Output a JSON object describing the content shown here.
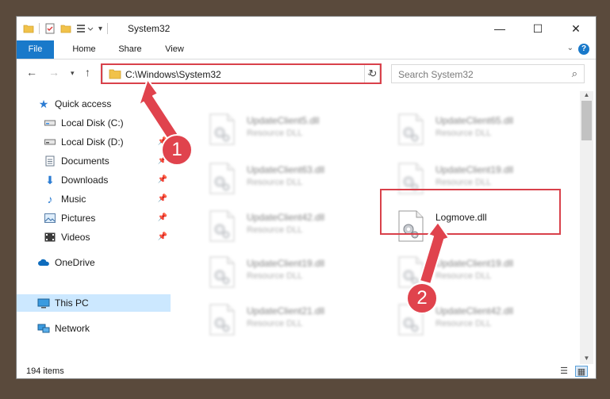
{
  "window": {
    "title": "System32"
  },
  "ribbon": {
    "tabs": [
      "File",
      "Home",
      "Share",
      "View"
    ]
  },
  "address": {
    "path": "C:\\Windows\\System32"
  },
  "search": {
    "placeholder": "Search System32"
  },
  "nav": {
    "items": [
      {
        "label": "Quick access",
        "icon": "star-icon"
      },
      {
        "label": "Local Disk (C:)",
        "icon": "drive-icon",
        "pinned": true
      },
      {
        "label": "Local Disk (D:)",
        "icon": "drive-icon",
        "pinned": true
      },
      {
        "label": "Documents",
        "icon": "documents-icon",
        "pinned": true
      },
      {
        "label": "Downloads",
        "icon": "downloads-icon",
        "pinned": true
      },
      {
        "label": "Music",
        "icon": "music-icon",
        "pinned": true
      },
      {
        "label": "Pictures",
        "icon": "pictures-icon",
        "pinned": true
      },
      {
        "label": "Videos",
        "icon": "videos-icon",
        "pinned": true
      },
      {
        "label": "OneDrive",
        "icon": "cloud-icon"
      },
      {
        "label": "This PC",
        "icon": "pc-icon",
        "selected": true
      },
      {
        "label": "Network",
        "icon": "network-icon"
      }
    ]
  },
  "files": [
    {
      "name": "UpdateClient5.dll",
      "type": "Resource DLL",
      "blurred": true
    },
    {
      "name": "UpdateClient65.dll",
      "type": "Resource DLL",
      "blurred": true
    },
    {
      "name": "UpdateClient63.dll",
      "type": "Resource DLL",
      "blurred": true
    },
    {
      "name": "UpdateClient19.dll",
      "type": "Resource DLL",
      "blurred": true
    },
    {
      "name": "UpdateClient42.dll",
      "type": "Resource DLL",
      "blurred": true
    },
    {
      "name": "Logmove.dll",
      "type": "",
      "blurred": false
    },
    {
      "name": "UpdateClient19.dll",
      "type": "Resource DLL",
      "blurred": true
    },
    {
      "name": "UpdateClient19.dll",
      "type": "Resource DLL",
      "blurred": true
    },
    {
      "name": "UpdateClient21.dll",
      "type": "Resource DLL",
      "blurred": true
    },
    {
      "name": "UpdateClient42.dll",
      "type": "Resource DLL",
      "blurred": true
    }
  ],
  "status": {
    "item_count": "194 items"
  },
  "annotations": {
    "step1": "1",
    "step2": "2"
  },
  "colors": {
    "accent": "#1979ca",
    "highlight": "#d9414b",
    "selected": "#cce8ff"
  }
}
